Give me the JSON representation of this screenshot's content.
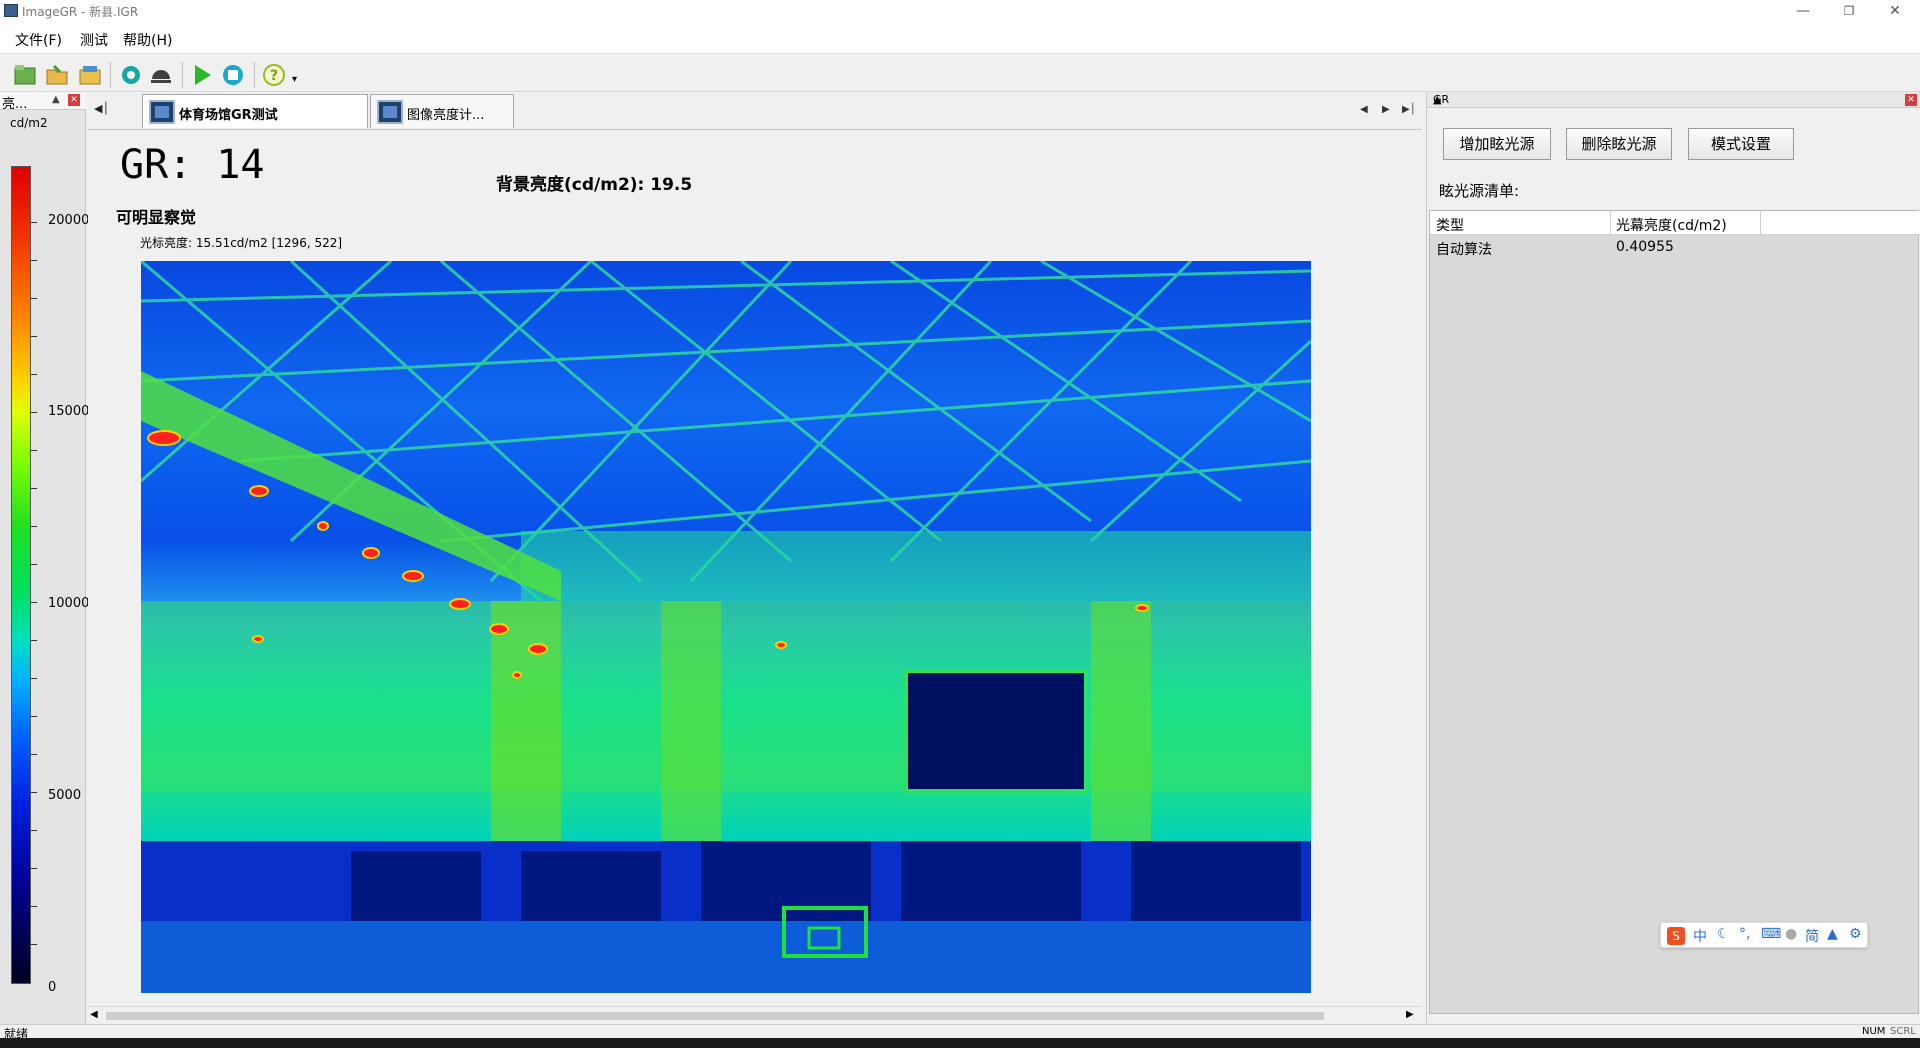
{
  "window": {
    "title": "ImageGR - 新县.IGR"
  },
  "menu": [
    "文件(F)",
    "测试",
    "帮助(H)"
  ],
  "left_panel": {
    "title": "亮...",
    "unit": "cd/m2",
    "scale_labels": [
      "20000",
      "15000",
      "10000",
      "5000",
      "0"
    ]
  },
  "tabs": [
    {
      "label": "体育场馆GR测试",
      "active": true
    },
    {
      "label": "图像亮度计...",
      "active": false
    }
  ],
  "result": {
    "gr": "GR: 14",
    "background": "背景亮度(cd/m2): 19.5",
    "verdict": "可明显察觉",
    "cursor": "光标亮度: 15.51cd/m2 [1296, 522]"
  },
  "right_panel": {
    "title": "GR",
    "buttons": {
      "add": "增加眩光源",
      "delete": "删除眩光源",
      "mode": "模式设置"
    },
    "list_label": "眩光源清单:",
    "table": {
      "headers": [
        "类型",
        "光幕亮度(cd/m2)"
      ],
      "rows": [
        [
          "自动算法",
          "0.40955"
        ]
      ]
    }
  },
  "ime": {
    "logo": "S",
    "lang": "中",
    "simplified": "简"
  },
  "status": {
    "text": "就绪",
    "num": "NUM",
    "scrl": "SCRL"
  },
  "colors": {
    "accent": "#3a5f8f",
    "close": "#d04040"
  },
  "icons": [
    "new-file-icon",
    "open-folder-icon",
    "save-icon",
    "settings-icon",
    "capture-icon",
    "play-icon",
    "stop-icon",
    "help-icon"
  ]
}
